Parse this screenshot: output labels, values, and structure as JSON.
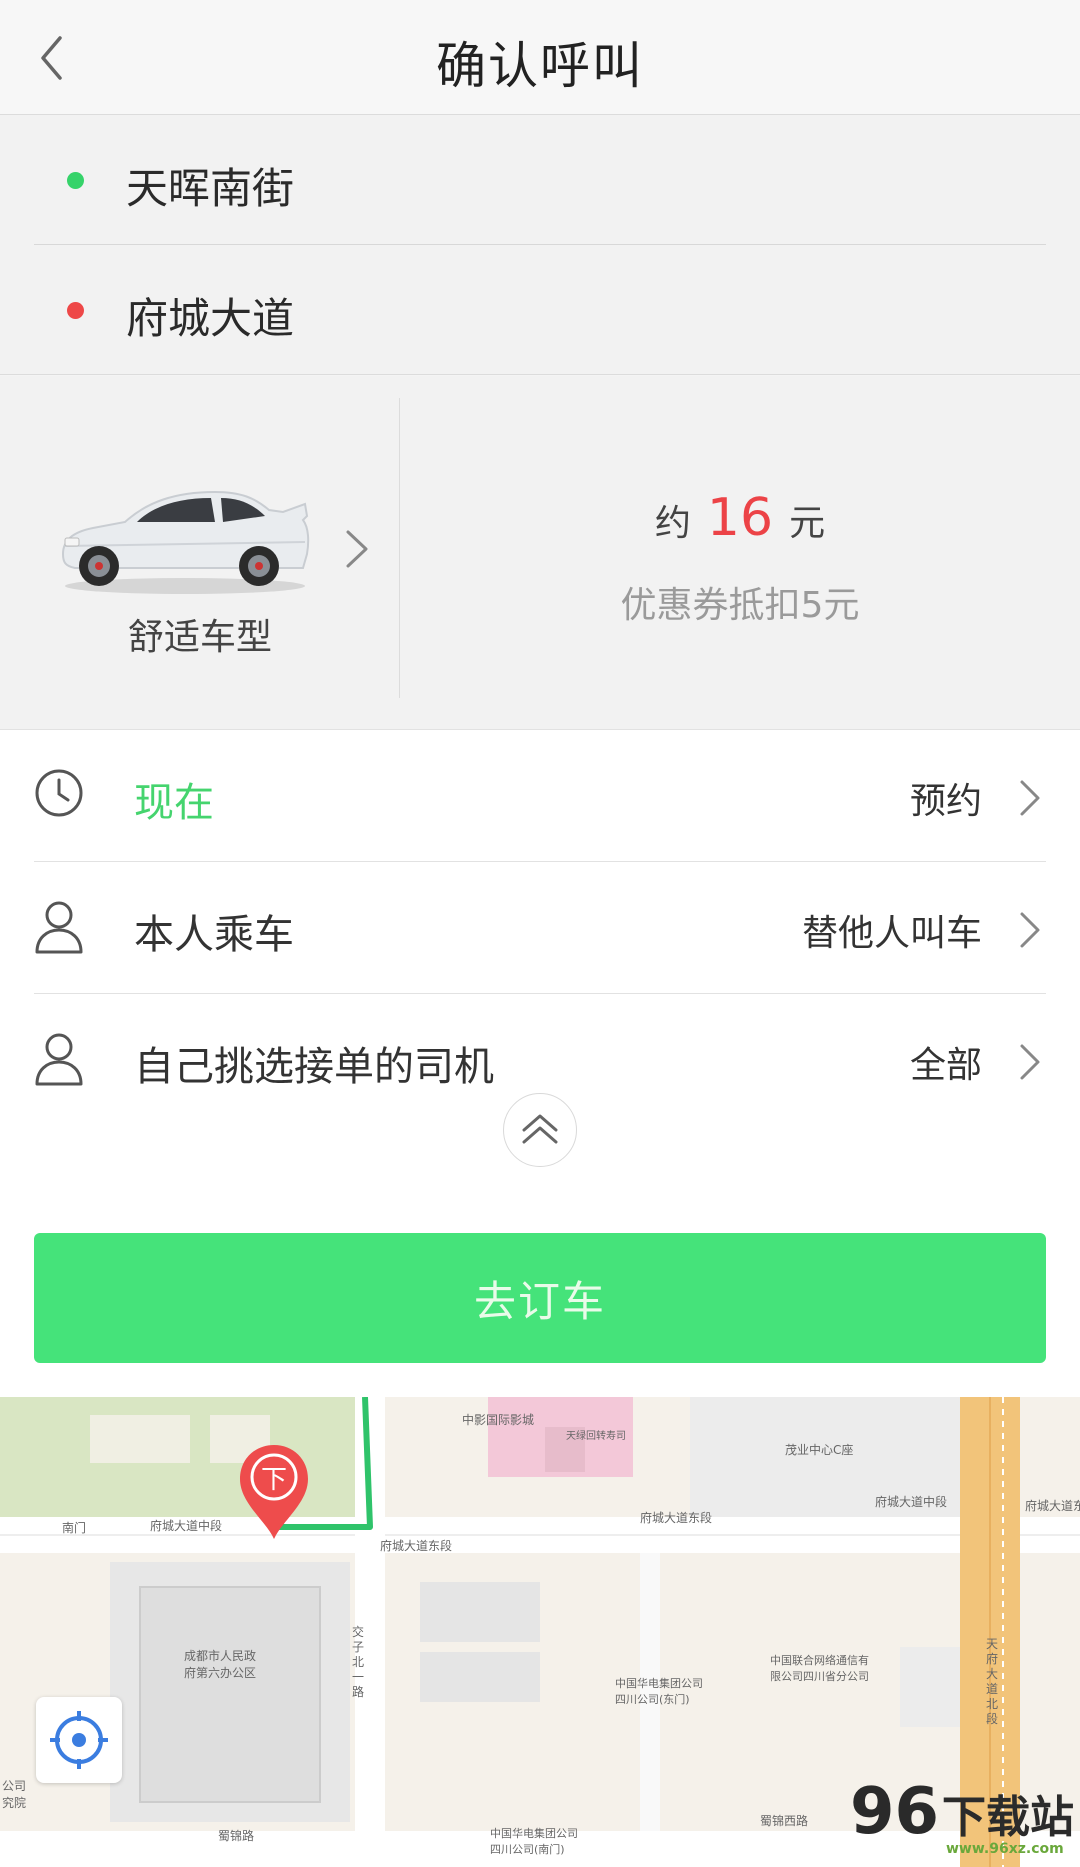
{
  "header": {
    "title": "确认呼叫",
    "back_icon": "chevron-left-icon"
  },
  "route": {
    "start": "天晖南街",
    "end": "府城大道",
    "start_color": "#36d36a",
    "end_color": "#ee4848"
  },
  "car": {
    "type_label": "舒适车型"
  },
  "price": {
    "prefix": "约",
    "amount": "16",
    "unit": "元",
    "coupon": "优惠券抵扣5元",
    "accent": "#ec4347"
  },
  "options": [
    {
      "icon": "clock-icon",
      "label": "现在",
      "right": "预约"
    },
    {
      "icon": "person-icon",
      "label": "本人乘车",
      "right": "替他人叫车"
    },
    {
      "icon": "person-icon",
      "label": "自己挑选接单的司机",
      "right": "全部"
    }
  ],
  "order_button": {
    "label": "去订车",
    "color": "#45e37a"
  },
  "map": {
    "marker_label": "下",
    "labels": [
      "中影国际影城",
      "天绿回转寿司",
      "茂业中心C座",
      "府城大道东段",
      "府城大道中段",
      "府城大道中段",
      "府城大道东段",
      "府城大道东",
      "南门",
      "成都市人民政府第六办公区",
      "中国联合网络通信有限公司四川省分公司",
      "中国华电集团公司四川公司(东门)",
      "中国华电集团公司四川公司(南门)",
      "蜀锦西路",
      "蜀锦路",
      "交子北一路",
      "天府大道北段",
      "公司究院"
    ]
  },
  "watermark": {
    "text": "下载站",
    "number": "96",
    "url": "www.96xz.com"
  }
}
